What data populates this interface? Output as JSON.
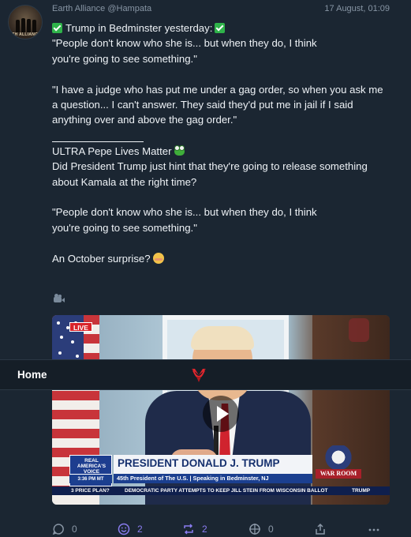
{
  "post": {
    "author_name": "Earth Alliance",
    "author_handle": "@Hampata",
    "date": "17 August, 01:09",
    "avatar_caption": "4TH ALLIANCE",
    "lines_block1": [
      "Trump in Bedminster yesterday:",
      "\"People don't know who she is... but when they do, I think",
      "you're going to see something.\""
    ],
    "lines_block2": [
      "\"I have a judge who has put me under a gag order, so when you ask me",
      "a question... I can't answer. They said they'd put me in jail if I said",
      "anything over and above the gag order.\""
    ],
    "lines_block3": [
      "ULTRA Pepe Lives Matter",
      "Did President Trump just hint that they're going to release something",
      "about Kamala at the right time?"
    ],
    "lines_block4": [
      "\"People don't know who she is... but when they do, I think",
      "you're going to see something.\""
    ],
    "line_block5": "An October surprise?"
  },
  "video": {
    "live_badge": "LIVE",
    "brand_line": "REAL AMERICA'S VOICE",
    "time": "3:36 PM MT",
    "banner_title": "PRESIDENT DONALD J. TRUMP",
    "banner_sub": "45th President of The U.S. | Speaking in Bedminster, NJ",
    "ticker": [
      "3 PRICE PLAN?",
      "DEMOCRATIC PARTY ATTEMPTS TO KEEP JILL STEIN FROM WISCONSIN BALLOT",
      "TRUMP"
    ],
    "warroom_label": "WAR ROOM"
  },
  "nav": {
    "home_label": "Home",
    "logo_icon": "app-logo-icon"
  },
  "actions": {
    "reply_count": "0",
    "like_count": "2",
    "repost_count": "2",
    "quote_count": "0"
  },
  "colors": {
    "background": "#1b2632",
    "accent": "#8a7cf0",
    "nav_bg": "#151e27",
    "check_green": "#2fb34a"
  }
}
